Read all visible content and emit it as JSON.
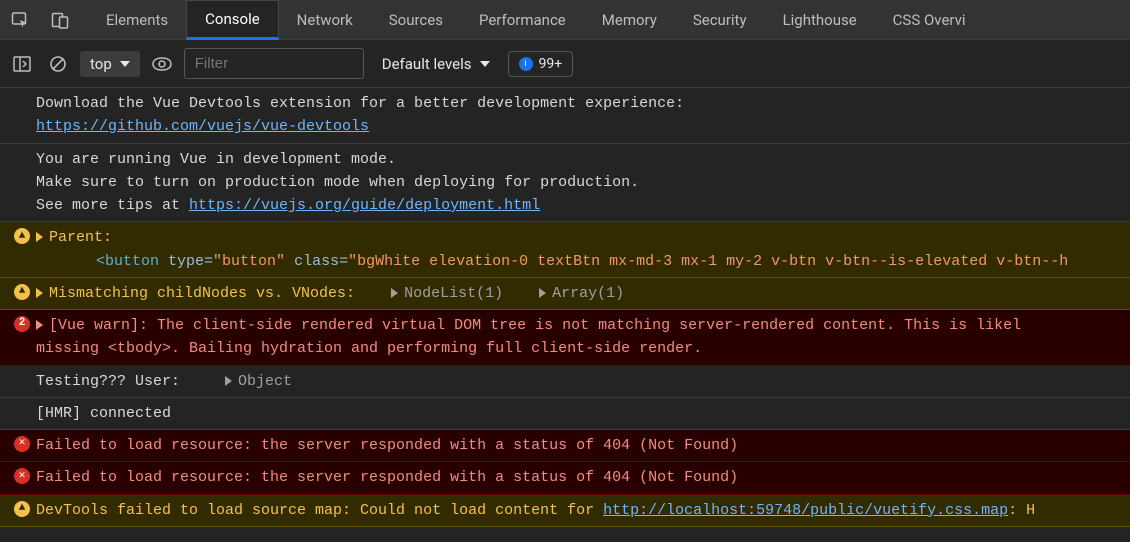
{
  "tabs": [
    "Elements",
    "Console",
    "Network",
    "Sources",
    "Performance",
    "Memory",
    "Security",
    "Lighthouse",
    "CSS Overvi"
  ],
  "active_tab": "Console",
  "toolbar": {
    "context": "top",
    "filter_placeholder": "Filter",
    "levels_label": "Default levels",
    "issues_count": "99+"
  },
  "logs": {
    "row0": {
      "line1": "Download the Vue Devtools extension for a better development experience:",
      "link": "https://github.com/vuejs/vue-devtools"
    },
    "row1": {
      "line1": "You are running Vue in development mode.",
      "line2": "Make sure to turn on production mode when deploying for production.",
      "line3_prefix": "See more tips at ",
      "link": "https://vuejs.org/guide/deployment.html"
    },
    "row2": {
      "label": "Parent:",
      "tag_open": "<button",
      "attr1_name": "type=",
      "attr1_val": "\"button\"",
      "attr2_name": "class=",
      "attr2_val": "\"bgWhite elevation-0 textBtn mx-md-3 mx-1 my-2 v-btn v-btn--is-elevated v-btn--h"
    },
    "row3": {
      "label": "Mismatching childNodes vs. VNodes:",
      "obj1": "NodeList(1)",
      "obj2": "Array(1)"
    },
    "row4": {
      "badge": "2",
      "text": "[Vue warn]: The client-side rendered virtual DOM tree is not matching server-rendered content. This is likel",
      "text2": "missing <tbody>. Bailing hydration and performing full client-side render."
    },
    "row5": {
      "label": "Testing??? User:",
      "obj": "Object"
    },
    "row6": {
      "text": "[HMR] connected"
    },
    "row7": {
      "text": "Failed to load resource: the server responded with a status of 404 (Not Found)"
    },
    "row8": {
      "text": "Failed to load resource: the server responded with a status of 404 (Not Found)"
    },
    "row9": {
      "prefix": "DevTools failed to load source map: Could not load content for ",
      "link": "http://localhost:59748/public/vuetify.css.map",
      "suffix": ": H"
    }
  }
}
